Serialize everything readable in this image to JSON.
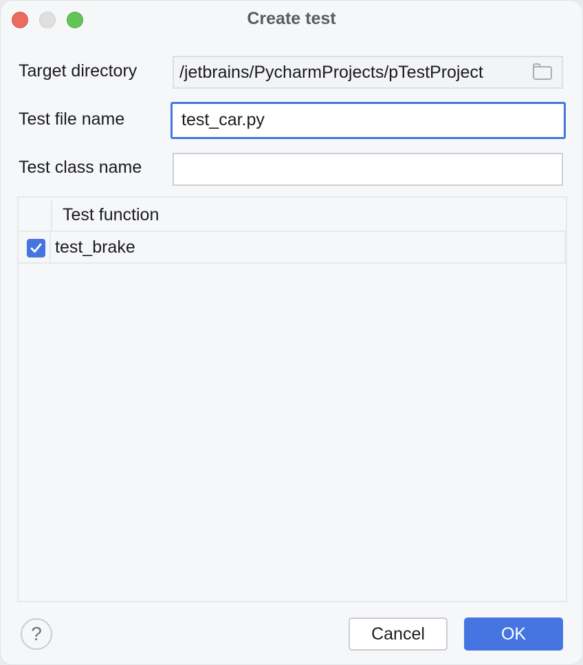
{
  "window": {
    "title": "Create test"
  },
  "form": {
    "target_directory": {
      "label": "Target directory",
      "value": "/jetbrains/PycharmProjects/pTestProject"
    },
    "test_file_name": {
      "label": "Test file name",
      "value": "test_car.py"
    },
    "test_class_name": {
      "label": "Test class name",
      "value": ""
    }
  },
  "table": {
    "column_header": "Test function",
    "rows": [
      {
        "checked": true,
        "name": "test_brake"
      }
    ]
  },
  "footer": {
    "help_label": "?",
    "cancel_label": "Cancel",
    "ok_label": "OK"
  },
  "colors": {
    "accent": "#4675e2",
    "background": "#f6f7f9"
  }
}
